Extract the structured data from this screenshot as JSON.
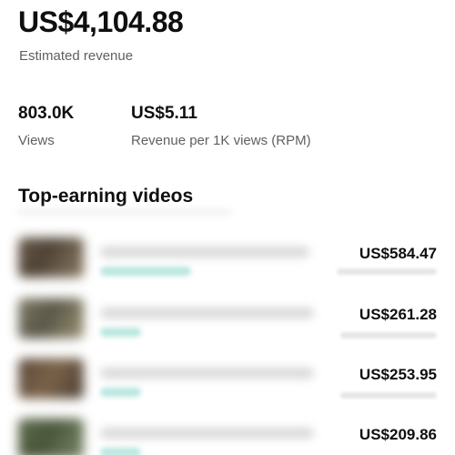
{
  "summary": {
    "estimated_revenue": "US$4,104.88",
    "estimated_revenue_label": "Estimated revenue",
    "views": "803.0K",
    "views_label": "Views",
    "rpm": "US$5.11",
    "rpm_label": "Revenue per 1K views (RPM)"
  },
  "top_videos": {
    "title": "Top-earning videos",
    "items": [
      {
        "revenue": "US$584.47"
      },
      {
        "revenue": "US$261.28"
      },
      {
        "revenue": "US$253.95"
      },
      {
        "revenue": "US$209.86"
      }
    ]
  },
  "colors": {
    "text_primary": "#0f0f0f",
    "text_secondary": "#606060",
    "background": "#ffffff",
    "tag_accent": "#b9e6df"
  }
}
